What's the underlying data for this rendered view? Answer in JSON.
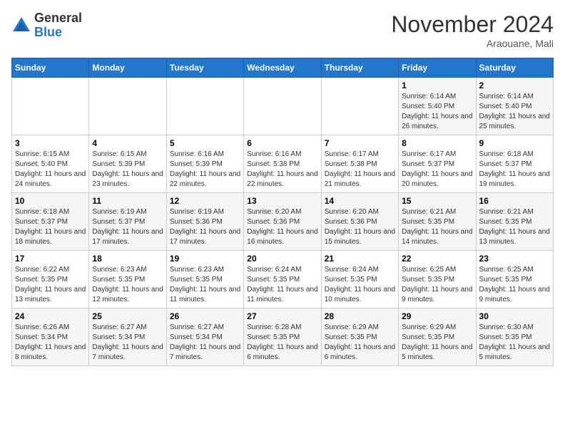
{
  "logo": {
    "general": "General",
    "blue": "Blue"
  },
  "header": {
    "month": "November 2024",
    "location": "Araouane, Mali"
  },
  "weekdays": [
    "Sunday",
    "Monday",
    "Tuesday",
    "Wednesday",
    "Thursday",
    "Friday",
    "Saturday"
  ],
  "weeks": [
    [
      {
        "day": "",
        "info": ""
      },
      {
        "day": "",
        "info": ""
      },
      {
        "day": "",
        "info": ""
      },
      {
        "day": "",
        "info": ""
      },
      {
        "day": "",
        "info": ""
      },
      {
        "day": "1",
        "info": "Sunrise: 6:14 AM\nSunset: 5:40 PM\nDaylight: 11 hours and 26 minutes."
      },
      {
        "day": "2",
        "info": "Sunrise: 6:14 AM\nSunset: 5:40 PM\nDaylight: 11 hours and 25 minutes."
      }
    ],
    [
      {
        "day": "3",
        "info": "Sunrise: 6:15 AM\nSunset: 5:40 PM\nDaylight: 11 hours and 24 minutes."
      },
      {
        "day": "4",
        "info": "Sunrise: 6:15 AM\nSunset: 5:39 PM\nDaylight: 11 hours and 23 minutes."
      },
      {
        "day": "5",
        "info": "Sunrise: 6:16 AM\nSunset: 5:39 PM\nDaylight: 11 hours and 22 minutes."
      },
      {
        "day": "6",
        "info": "Sunrise: 6:16 AM\nSunset: 5:38 PM\nDaylight: 11 hours and 22 minutes."
      },
      {
        "day": "7",
        "info": "Sunrise: 6:17 AM\nSunset: 5:38 PM\nDaylight: 11 hours and 21 minutes."
      },
      {
        "day": "8",
        "info": "Sunrise: 6:17 AM\nSunset: 5:37 PM\nDaylight: 11 hours and 20 minutes."
      },
      {
        "day": "9",
        "info": "Sunrise: 6:18 AM\nSunset: 5:37 PM\nDaylight: 11 hours and 19 minutes."
      }
    ],
    [
      {
        "day": "10",
        "info": "Sunrise: 6:18 AM\nSunset: 5:37 PM\nDaylight: 11 hours and 18 minutes."
      },
      {
        "day": "11",
        "info": "Sunrise: 6:19 AM\nSunset: 5:37 PM\nDaylight: 11 hours and 17 minutes."
      },
      {
        "day": "12",
        "info": "Sunrise: 6:19 AM\nSunset: 5:36 PM\nDaylight: 11 hours and 17 minutes."
      },
      {
        "day": "13",
        "info": "Sunrise: 6:20 AM\nSunset: 5:36 PM\nDaylight: 11 hours and 16 minutes."
      },
      {
        "day": "14",
        "info": "Sunrise: 6:20 AM\nSunset: 5:36 PM\nDaylight: 11 hours and 15 minutes."
      },
      {
        "day": "15",
        "info": "Sunrise: 6:21 AM\nSunset: 5:35 PM\nDaylight: 11 hours and 14 minutes."
      },
      {
        "day": "16",
        "info": "Sunrise: 6:21 AM\nSunset: 5:35 PM\nDaylight: 11 hours and 13 minutes."
      }
    ],
    [
      {
        "day": "17",
        "info": "Sunrise: 6:22 AM\nSunset: 5:35 PM\nDaylight: 11 hours and 13 minutes."
      },
      {
        "day": "18",
        "info": "Sunrise: 6:23 AM\nSunset: 5:35 PM\nDaylight: 11 hours and 12 minutes."
      },
      {
        "day": "19",
        "info": "Sunrise: 6:23 AM\nSunset: 5:35 PM\nDaylight: 11 hours and 11 minutes."
      },
      {
        "day": "20",
        "info": "Sunrise: 6:24 AM\nSunset: 5:35 PM\nDaylight: 11 hours and 11 minutes."
      },
      {
        "day": "21",
        "info": "Sunrise: 6:24 AM\nSunset: 5:35 PM\nDaylight: 11 hours and 10 minutes."
      },
      {
        "day": "22",
        "info": "Sunrise: 6:25 AM\nSunset: 5:35 PM\nDaylight: 11 hours and 9 minutes."
      },
      {
        "day": "23",
        "info": "Sunrise: 6:25 AM\nSunset: 5:35 PM\nDaylight: 11 hours and 9 minutes."
      }
    ],
    [
      {
        "day": "24",
        "info": "Sunrise: 6:26 AM\nSunset: 5:34 PM\nDaylight: 11 hours and 8 minutes."
      },
      {
        "day": "25",
        "info": "Sunrise: 6:27 AM\nSunset: 5:34 PM\nDaylight: 11 hours and 7 minutes."
      },
      {
        "day": "26",
        "info": "Sunrise: 6:27 AM\nSunset: 5:34 PM\nDaylight: 11 hours and 7 minutes."
      },
      {
        "day": "27",
        "info": "Sunrise: 6:28 AM\nSunset: 5:35 PM\nDaylight: 11 hours and 6 minutes."
      },
      {
        "day": "28",
        "info": "Sunrise: 6:29 AM\nSunset: 5:35 PM\nDaylight: 11 hours and 6 minutes."
      },
      {
        "day": "29",
        "info": "Sunrise: 6:29 AM\nSunset: 5:35 PM\nDaylight: 11 hours and 5 minutes."
      },
      {
        "day": "30",
        "info": "Sunrise: 6:30 AM\nSunset: 5:35 PM\nDaylight: 11 hours and 5 minutes."
      }
    ]
  ]
}
